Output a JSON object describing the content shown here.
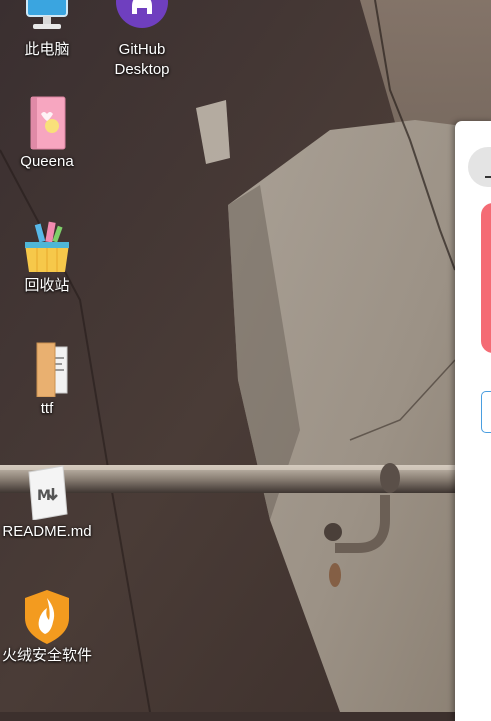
{
  "desktop": {
    "icons": [
      {
        "id": "this-pc",
        "label": "此电脑",
        "icon": "computer-icon"
      },
      {
        "id": "github-desktop",
        "label": "GitHub\nDesktop",
        "icon": "github-desktop-icon"
      },
      {
        "id": "queena",
        "label": "Queena",
        "icon": "notebook-icon"
      },
      {
        "id": "recycle-bin",
        "label": "回收站",
        "icon": "recycle-bin-icon"
      },
      {
        "id": "ttf",
        "label": "ttf",
        "icon": "folder-icon"
      },
      {
        "id": "readme",
        "label": "README.md",
        "icon": "markdown-file-icon"
      },
      {
        "id": "huorong",
        "label": "火绒安全软件",
        "icon": "huorong-shield-icon"
      }
    ]
  },
  "colors": {
    "window_bg": "#ffffff",
    "banner": "#f46b74",
    "outline_accent": "#4a9ee0",
    "github_purple": "#6f3fbf"
  }
}
